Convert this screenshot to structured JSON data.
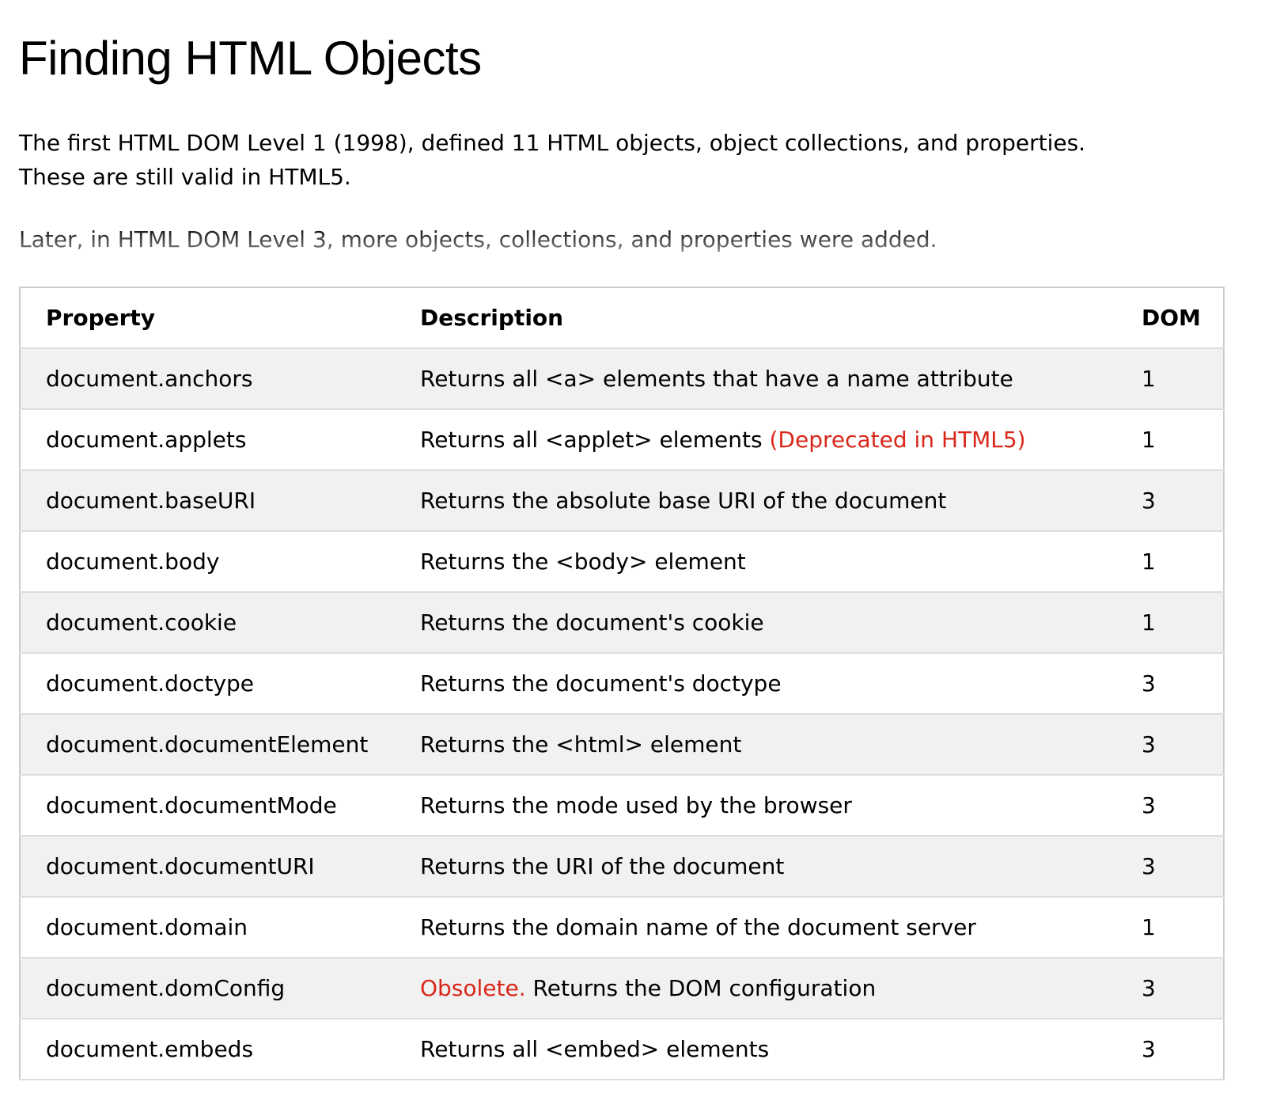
{
  "heading": "Finding HTML Objects",
  "intro": {
    "p1_line1": "The first HTML DOM Level 1 (1998), defined 11 HTML objects, object collections, and properties.",
    "p1_line2": "These are still valid in HTML5.",
    "p2": "Later, in HTML DOM Level 3, more objects, collections, and properties were added."
  },
  "table": {
    "headers": [
      "Property",
      "Description",
      "DOM"
    ],
    "rows": [
      {
        "property": "document.anchors",
        "prefix": "",
        "description": "Returns all <a> elements that have a name attribute",
        "note": "",
        "dom": "1"
      },
      {
        "property": "document.applets",
        "prefix": "",
        "description": "Returns all <applet> elements ",
        "note": "(Deprecated in HTML5)",
        "dom": "1"
      },
      {
        "property": "document.baseURI",
        "prefix": "",
        "description": "Returns the absolute base URI of the document",
        "note": "",
        "dom": "3"
      },
      {
        "property": "document.body",
        "prefix": "",
        "description": "Returns the <body> element",
        "note": "",
        "dom": "1"
      },
      {
        "property": "document.cookie",
        "prefix": "",
        "description": "Returns the document's cookie",
        "note": "",
        "dom": "1"
      },
      {
        "property": "document.doctype",
        "prefix": "",
        "description": "Returns the document's doctype",
        "note": "",
        "dom": "3"
      },
      {
        "property": "document.documentElement",
        "prefix": "",
        "description": "Returns the <html> element",
        "note": "",
        "dom": "3"
      },
      {
        "property": "document.documentMode",
        "prefix": "",
        "description": "Returns the mode used by the browser",
        "note": "",
        "dom": "3"
      },
      {
        "property": "document.documentURI",
        "prefix": "",
        "description": "Returns the URI of the document",
        "note": "",
        "dom": "3"
      },
      {
        "property": "document.domain",
        "prefix": "",
        "description": "Returns the domain name of the document server",
        "note": "",
        "dom": "1"
      },
      {
        "property": "document.domConfig",
        "prefix": "Obsolete. ",
        "description": "Returns the DOM configuration",
        "note": "",
        "dom": "3"
      },
      {
        "property": "document.embeds",
        "prefix": "",
        "description": "Returns all <embed> elements",
        "note": "",
        "dom": "3"
      }
    ]
  },
  "colors": {
    "warning_text": "#d9281a",
    "row_alt": "#f1f1f1",
    "border": "#cccccc"
  }
}
